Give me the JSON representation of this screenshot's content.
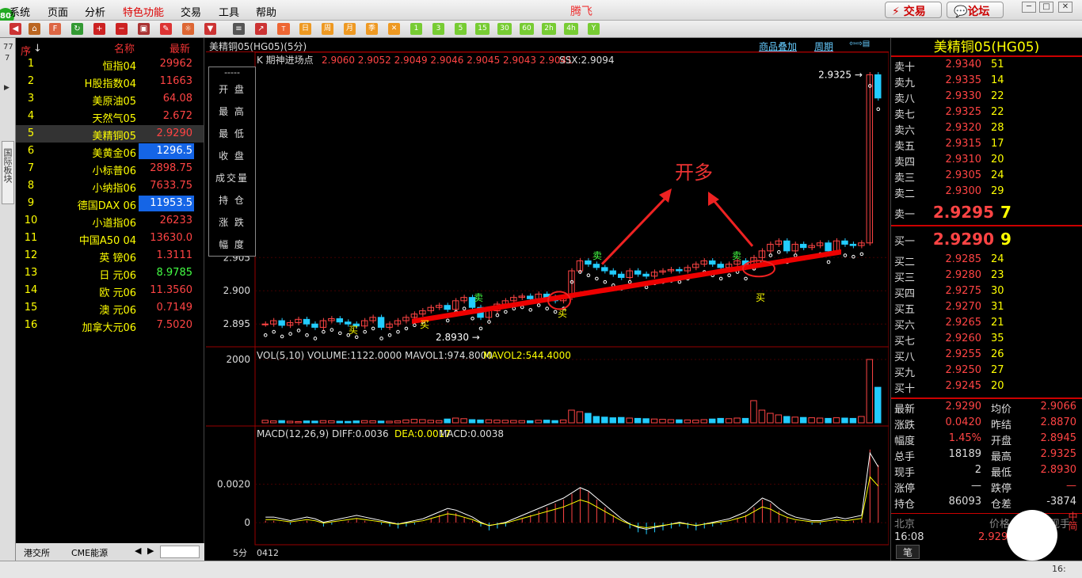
{
  "app": {
    "title": "腾飞",
    "menu": [
      "系统",
      "页面",
      "分析",
      "特色功能",
      "交易",
      "工具",
      "帮助"
    ],
    "trade_button": "交易",
    "forum_button": "论坛",
    "badge": "80"
  },
  "toolbar": {
    "labels": [
      "日",
      "周",
      "月",
      "季",
      "1",
      "3",
      "5",
      "15",
      "30",
      "60",
      "2h",
      "4h",
      "Y"
    ]
  },
  "sidebar_tab": "国际板块",
  "sidebar_nums": [
    "77",
    "7"
  ],
  "list": {
    "headers": {
      "seq": "序",
      "name": "名称",
      "last": "最新"
    },
    "rows": [
      {
        "no": "1",
        "name": "恒指04",
        "price": "29962"
      },
      {
        "no": "2",
        "name": "H股指数04",
        "price": "11663"
      },
      {
        "no": "3",
        "name": "美原油05",
        "price": "64.08"
      },
      {
        "no": "4",
        "name": "天然气05",
        "price": "2.672"
      },
      {
        "no": "5",
        "name": "美精铜05",
        "price": "2.9290"
      },
      {
        "no": "6",
        "name": "美黄金06",
        "price": "1296.5"
      },
      {
        "no": "7",
        "name": "小标普06",
        "price": "2898.75"
      },
      {
        "no": "8",
        "name": "小纳指06",
        "price": "7633.75"
      },
      {
        "no": "9",
        "name": "德国DAX 06",
        "price": "11953.5"
      },
      {
        "no": "10",
        "name": "小道指06",
        "price": "26233"
      },
      {
        "no": "11",
        "name": "中国A50 04",
        "price": "13630.0"
      },
      {
        "no": "12",
        "name": "英 镑06",
        "price": "1.3111"
      },
      {
        "no": "13",
        "name": "日 元06",
        "price": "8.9785"
      },
      {
        "no": "14",
        "name": "欧 元06",
        "price": "11.3560"
      },
      {
        "no": "15",
        "name": "澳 元06",
        "price": "0.7149"
      },
      {
        "no": "16",
        "name": "加拿大元06",
        "price": "7.5020"
      }
    ],
    "foot_tabs": [
      "港交所",
      "CME能源"
    ]
  },
  "chart": {
    "title": "美精铜05(HG05)(5分)",
    "overlay_link": "商品叠加",
    "period_link": "周期",
    "kline_label": "K  期神进场点",
    "kline_values": "2.9060 2.9052 2.9049 2.9046 2.9045 2.9043 2.9041",
    "ssx": "SSX:2.9094",
    "info_box": [
      "开 盘",
      "最 高",
      "最 低",
      "收 盘",
      "成交量",
      "持 仓",
      "涨 跌",
      "幅 度"
    ],
    "high_label": "2.9325",
    "low_label": "2.8930",
    "annotation": "开多",
    "buy_mark": "买",
    "sell_mark": "卖",
    "vol_label": "VOL(5,10) VOLUME:1122.0000 MAVOL1:974.8000",
    "mavol2": "MAVOL2:544.4000",
    "macd_label": "MACD(12,26,9) DIFF:0.0036",
    "dea": "DEA:0.0017",
    "macd_val": "MACD:0.0038",
    "period_footer": "5分",
    "date_footer": "0412"
  },
  "chart_data": {
    "type": "candlestick",
    "price_ticks": [
      2.895,
      2.9,
      2.905
    ],
    "vol_ticks": [
      2000
    ],
    "macd_ticks": [
      0.002,
      0
    ],
    "closes": [
      2.895,
      2.8955,
      2.8948,
      2.8952,
      2.8957,
      2.895,
      2.8945,
      2.8955,
      2.8958,
      2.8953,
      2.895,
      2.8947,
      2.8955,
      2.896,
      2.8945,
      2.895,
      2.8955,
      2.896,
      2.8965,
      2.897,
      2.8975,
      2.8978,
      2.8972,
      2.8985,
      2.899,
      2.8975,
      2.896,
      2.897,
      2.898,
      2.8985,
      2.899,
      2.8992,
      2.8988,
      2.8995,
      2.899,
      2.8985,
      2.899,
      2.903,
      2.9045,
      2.904,
      2.9035,
      2.903,
      2.9025,
      2.902,
      2.903,
      2.9025,
      2.9022,
      2.9028,
      2.903,
      2.9032,
      2.903,
      2.9035,
      2.904,
      2.9045,
      2.904,
      2.9035,
      2.904,
      2.9045,
      2.9035,
      2.905,
      2.906,
      2.907,
      2.9075,
      2.906,
      2.907,
      2.9065,
      2.9068,
      2.9072,
      2.906,
      2.9075,
      2.907,
      2.9068,
      2.9072,
      2.9325,
      2.929
    ],
    "volumes": [
      80,
      60,
      70,
      50,
      40,
      60,
      55,
      70,
      65,
      50,
      45,
      60,
      70,
      65,
      55,
      50,
      60,
      90,
      110,
      100,
      80,
      70,
      120,
      150,
      130,
      100,
      90,
      95,
      85,
      80,
      75,
      70,
      65,
      80,
      85,
      70,
      90,
      400,
      350,
      300,
      200,
      180,
      160,
      170,
      150,
      140,
      130,
      120,
      110,
      100,
      95,
      90,
      85,
      100,
      120,
      140,
      130,
      150,
      140,
      700,
      400,
      300,
      250,
      200,
      180,
      170,
      160,
      150,
      140,
      160,
      150,
      140,
      200,
      2000,
      1122
    ],
    "macd_bars": [
      0.0001,
      0.0001,
      0.0,
      -0.0001,
      0.0,
      0.0001,
      0.0,
      -0.0002,
      -0.0001,
      0.0,
      0.0001,
      0.0002,
      0.0001,
      0.0,
      -0.0001,
      -0.0002,
      -0.0003,
      -0.0002,
      -0.0001,
      0.0,
      0.0002,
      0.0004,
      0.0006,
      0.0005,
      0.0003,
      0.0001,
      -0.0002,
      -0.0004,
      -0.0003,
      -0.0002,
      0.0,
      0.0002,
      0.0004,
      0.0006,
      0.0008,
      0.001,
      0.0012,
      0.0015,
      0.0018,
      0.0016,
      0.0012,
      0.0008,
      0.0004,
      0.0,
      -0.0003,
      -0.0005,
      -0.0006,
      -0.0005,
      -0.0004,
      -0.0003,
      -0.0002,
      -0.0003,
      -0.0004,
      -0.0003,
      -0.0002,
      -0.0001,
      0.0,
      0.0002,
      0.0004,
      0.0008,
      0.0012,
      0.001,
      0.0006,
      0.0003,
      0.0001,
      0.0,
      -0.0001,
      -0.0001,
      0.0,
      0.0001,
      0.0,
      0.0001,
      0.0002,
      0.0038,
      0.003
    ]
  },
  "orderbook": {
    "title": "美精铜05(HG05)",
    "asks": [
      {
        "label": "卖十",
        "price": "2.9340",
        "vol": "51"
      },
      {
        "label": "卖九",
        "price": "2.9335",
        "vol": "14"
      },
      {
        "label": "卖八",
        "price": "2.9330",
        "vol": "22"
      },
      {
        "label": "卖七",
        "price": "2.9325",
        "vol": "22"
      },
      {
        "label": "卖六",
        "price": "2.9320",
        "vol": "28"
      },
      {
        "label": "卖五",
        "price": "2.9315",
        "vol": "17"
      },
      {
        "label": "卖四",
        "price": "2.9310",
        "vol": "20"
      },
      {
        "label": "卖三",
        "price": "2.9305",
        "vol": "24"
      },
      {
        "label": "卖二",
        "price": "2.9300",
        "vol": "29"
      }
    ],
    "ask1": {
      "label": "卖一",
      "price": "2.9295",
      "vol": "7"
    },
    "bid1": {
      "label": "买一",
      "price": "2.9290",
      "vol": "9"
    },
    "bids": [
      {
        "label": "买二",
        "price": "2.9285",
        "vol": "24"
      },
      {
        "label": "买三",
        "price": "2.9280",
        "vol": "23"
      },
      {
        "label": "买四",
        "price": "2.9275",
        "vol": "30"
      },
      {
        "label": "买五",
        "price": "2.9270",
        "vol": "31"
      },
      {
        "label": "买六",
        "price": "2.9265",
        "vol": "21"
      },
      {
        "label": "买七",
        "price": "2.9260",
        "vol": "35"
      },
      {
        "label": "买八",
        "price": "2.9255",
        "vol": "26"
      },
      {
        "label": "买九",
        "price": "2.9250",
        "vol": "27"
      },
      {
        "label": "买十",
        "price": "2.9245",
        "vol": "20"
      }
    ]
  },
  "stats": [
    {
      "l1": "最新",
      "v1": "2.9290",
      "l2": "均价",
      "v2": "2.9066"
    },
    {
      "l1": "涨跌",
      "v1": "0.0420",
      "l2": "昨结",
      "v2": "2.8870"
    },
    {
      "l1": "幅度",
      "v1": "1.45%",
      "l2": "开盘",
      "v2": "2.8945"
    },
    {
      "l1": "总手",
      "v1": "18189",
      "l2": "最高",
      "v2": "2.9325"
    },
    {
      "l1": "现手",
      "v1": "2",
      "l2": "最低",
      "v2": "2.8930"
    },
    {
      "l1": "涨停",
      "v1": "—",
      "l2": "跌停",
      "v2": "—"
    },
    {
      "l1": "持仓",
      "v1": "86093",
      "l2": "仓差",
      "v2": "-3874"
    }
  ],
  "ticks": {
    "header": [
      "北京",
      "价格",
      "现手"
    ],
    "time": "16:08",
    "price": "2.929",
    "tab": "笔"
  },
  "status": {
    "right": "16:"
  }
}
